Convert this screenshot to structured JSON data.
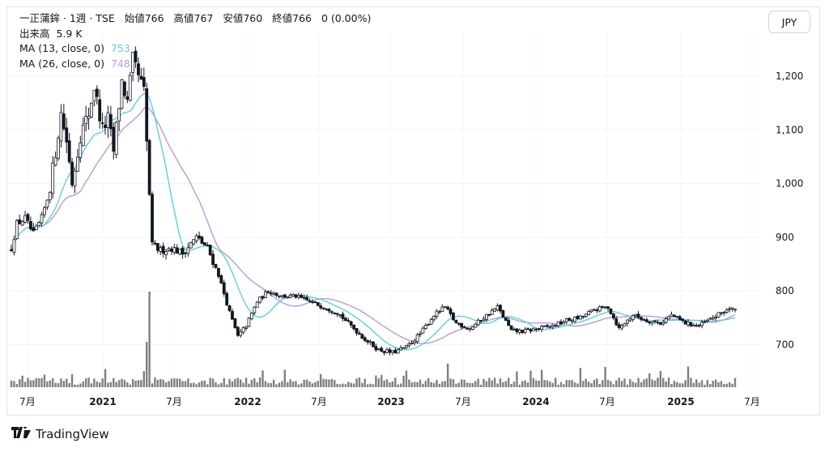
{
  "header": {
    "symbol_line": "一正蒲鉾 · 1週 · TSE",
    "open_label": "始値",
    "open": "766",
    "high_label": "高値",
    "high": "767",
    "low_label": "安値",
    "low": "760",
    "close_label": "終値",
    "close": "766",
    "change": "0 (0.00%)",
    "volume_label": "出来高",
    "volume": "5.9 K",
    "ma13_label": "MA (13, close, 0)",
    "ma13_value": "753",
    "ma26_label": "MA (26, close, 0)",
    "ma26_value": "748"
  },
  "currency_button": "JPY",
  "brand": "TradingView",
  "colors": {
    "candle": "#131722",
    "ma13": "#5ad1e0",
    "ma26": "#b49be0",
    "volume": "#7f7f7f"
  },
  "chart_data": {
    "type": "candlestick",
    "interval": "1週",
    "ylim": [
      650,
      1270
    ],
    "y_ticks": [
      "1,200",
      "1,100",
      "1,000",
      "900",
      "800",
      "700"
    ],
    "x_ticks": [
      "7月",
      "2021",
      "7月",
      "2022",
      "7月",
      "2023",
      "7月",
      "2024",
      "7月",
      "2025",
      "7月"
    ],
    "x_range": [
      "2020-05",
      "2025-07"
    ],
    "close_path": [
      [
        "2020-05-22",
        880
      ],
      [
        "2020-06-05",
        925
      ],
      [
        "2020-06-26",
        935
      ],
      [
        "2020-07-17",
        905
      ],
      [
        "2020-08-07",
        935
      ],
      [
        "2020-08-28",
        990
      ],
      [
        "2020-09-11",
        1060
      ],
      [
        "2020-09-25",
        1130
      ],
      [
        "2020-10-09",
        1080
      ],
      [
        "2020-10-23",
        1000
      ],
      [
        "2020-11-13",
        1090
      ],
      [
        "2020-12-04",
        1130
      ],
      [
        "2020-12-18",
        1180
      ],
      [
        "2021-01-08",
        1100
      ],
      [
        "2021-01-22",
        1120
      ],
      [
        "2021-02-05",
        1060
      ],
      [
        "2021-02-26",
        1190
      ],
      [
        "2021-03-12",
        1150
      ],
      [
        "2021-03-26",
        1230
      ],
      [
        "2021-04-09",
        1200
      ],
      [
        "2021-04-23",
        1170
      ],
      [
        "2021-05-14",
        885
      ],
      [
        "2021-06-04",
        875
      ],
      [
        "2021-07-02",
        880
      ],
      [
        "2021-07-30",
        870
      ],
      [
        "2021-09-03",
        900
      ],
      [
        "2021-10-01",
        880
      ],
      [
        "2021-10-29",
        830
      ],
      [
        "2021-11-26",
        760
      ],
      [
        "2021-12-17",
        715
      ],
      [
        "2022-01-07",
        735
      ],
      [
        "2022-02-04",
        780
      ],
      [
        "2022-03-04",
        800
      ],
      [
        "2022-04-08",
        790
      ],
      [
        "2022-05-13",
        790
      ],
      [
        "2022-06-17",
        780
      ],
      [
        "2022-07-22",
        770
      ],
      [
        "2022-08-26",
        760
      ],
      [
        "2022-09-30",
        735
      ],
      [
        "2022-11-04",
        710
      ],
      [
        "2022-12-09",
        690
      ],
      [
        "2023-01-13",
        685
      ],
      [
        "2023-02-17",
        695
      ],
      [
        "2023-03-24",
        720
      ],
      [
        "2023-04-28",
        755
      ],
      [
        "2023-05-26",
        770
      ],
      [
        "2023-06-23",
        740
      ],
      [
        "2023-07-28",
        730
      ],
      [
        "2023-09-01",
        750
      ],
      [
        "2023-10-06",
        770
      ],
      [
        "2023-11-10",
        725
      ],
      [
        "2023-12-15",
        725
      ],
      [
        "2024-01-19",
        730
      ],
      [
        "2024-02-23",
        735
      ],
      [
        "2024-03-29",
        745
      ],
      [
        "2024-05-03",
        750
      ],
      [
        "2024-06-07",
        765
      ],
      [
        "2024-07-12",
        770
      ],
      [
        "2024-08-09",
        730
      ],
      [
        "2024-09-13",
        755
      ],
      [
        "2024-10-18",
        745
      ],
      [
        "2024-11-22",
        740
      ],
      [
        "2024-12-20",
        755
      ],
      [
        "2025-01-24",
        740
      ],
      [
        "2025-02-28",
        735
      ],
      [
        "2025-04-04",
        750
      ],
      [
        "2025-05-09",
        765
      ],
      [
        "2025-05-30",
        766
      ]
    ],
    "volume_spikes": [
      [
        "2021-04-30",
        "large"
      ],
      [
        "2021-05-07",
        "very large"
      ],
      [
        "2023-06-02",
        "medium"
      ],
      [
        "2024-07-05",
        "medium"
      ],
      [
        "2025-01-31",
        "medium"
      ]
    ],
    "last": {
      "open": 766,
      "high": 767,
      "low": 760,
      "close": 766
    },
    "ma13_last": 753,
    "ma26_last": 748
  }
}
